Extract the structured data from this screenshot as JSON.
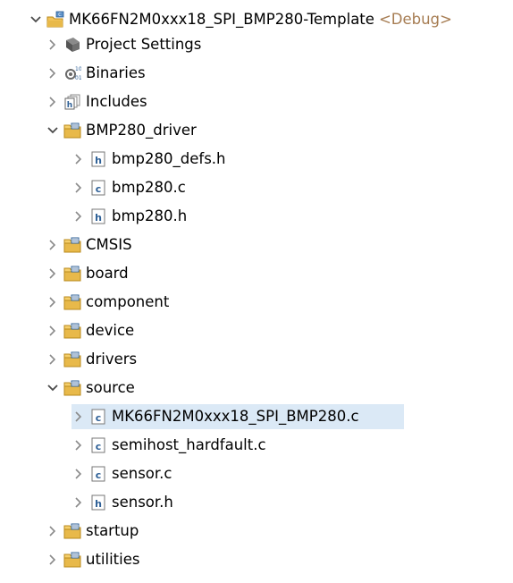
{
  "project": {
    "name": "MK66FN2M0xxx18_SPI_BMP280-Template",
    "decoration": "<Debug>"
  },
  "items": {
    "project_settings": "Project Settings",
    "binaries": "Binaries",
    "includes": "Includes",
    "bmp280_driver": "BMP280_driver",
    "bmp280_defs_h": "bmp280_defs.h",
    "bmp280_c": "bmp280.c",
    "bmp280_h": "bmp280.h",
    "cmsis": "CMSIS",
    "board": "board",
    "component": "component",
    "device": "device",
    "drivers": "drivers",
    "source": "source",
    "main_c": "MK66FN2M0xxx18_SPI_BMP280.c",
    "semihost_c": "semihost_hardfault.c",
    "sensor_c": "sensor.c",
    "sensor_h": "sensor.h",
    "startup": "startup",
    "utilities": "utilities"
  },
  "colors": {
    "selection": "#dbe9f6",
    "decoration": "#a67c52",
    "folder": "#e8b94a",
    "arrow": "#595959"
  }
}
